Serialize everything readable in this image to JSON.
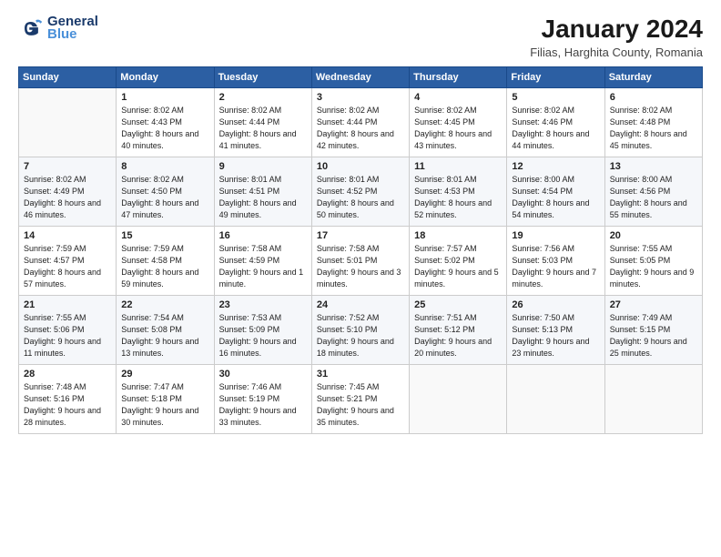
{
  "header": {
    "logo_line1": "General",
    "logo_line2": "Blue",
    "month_title": "January 2024",
    "location": "Filias, Harghita County, Romania"
  },
  "days_of_week": [
    "Sunday",
    "Monday",
    "Tuesday",
    "Wednesday",
    "Thursday",
    "Friday",
    "Saturday"
  ],
  "weeks": [
    [
      {
        "day": null,
        "sunrise": null,
        "sunset": null,
        "daylight": null
      },
      {
        "day": "1",
        "sunrise": "8:02 AM",
        "sunset": "4:43 PM",
        "daylight": "8 hours and 40 minutes."
      },
      {
        "day": "2",
        "sunrise": "8:02 AM",
        "sunset": "4:44 PM",
        "daylight": "8 hours and 41 minutes."
      },
      {
        "day": "3",
        "sunrise": "8:02 AM",
        "sunset": "4:44 PM",
        "daylight": "8 hours and 42 minutes."
      },
      {
        "day": "4",
        "sunrise": "8:02 AM",
        "sunset": "4:45 PM",
        "daylight": "8 hours and 43 minutes."
      },
      {
        "day": "5",
        "sunrise": "8:02 AM",
        "sunset": "4:46 PM",
        "daylight": "8 hours and 44 minutes."
      },
      {
        "day": "6",
        "sunrise": "8:02 AM",
        "sunset": "4:48 PM",
        "daylight": "8 hours and 45 minutes."
      }
    ],
    [
      {
        "day": "7",
        "sunrise": "8:02 AM",
        "sunset": "4:49 PM",
        "daylight": "8 hours and 46 minutes."
      },
      {
        "day": "8",
        "sunrise": "8:02 AM",
        "sunset": "4:50 PM",
        "daylight": "8 hours and 47 minutes."
      },
      {
        "day": "9",
        "sunrise": "8:01 AM",
        "sunset": "4:51 PM",
        "daylight": "8 hours and 49 minutes."
      },
      {
        "day": "10",
        "sunrise": "8:01 AM",
        "sunset": "4:52 PM",
        "daylight": "8 hours and 50 minutes."
      },
      {
        "day": "11",
        "sunrise": "8:01 AM",
        "sunset": "4:53 PM",
        "daylight": "8 hours and 52 minutes."
      },
      {
        "day": "12",
        "sunrise": "8:00 AM",
        "sunset": "4:54 PM",
        "daylight": "8 hours and 54 minutes."
      },
      {
        "day": "13",
        "sunrise": "8:00 AM",
        "sunset": "4:56 PM",
        "daylight": "8 hours and 55 minutes."
      }
    ],
    [
      {
        "day": "14",
        "sunrise": "7:59 AM",
        "sunset": "4:57 PM",
        "daylight": "8 hours and 57 minutes."
      },
      {
        "day": "15",
        "sunrise": "7:59 AM",
        "sunset": "4:58 PM",
        "daylight": "8 hours and 59 minutes."
      },
      {
        "day": "16",
        "sunrise": "7:58 AM",
        "sunset": "4:59 PM",
        "daylight": "9 hours and 1 minute."
      },
      {
        "day": "17",
        "sunrise": "7:58 AM",
        "sunset": "5:01 PM",
        "daylight": "9 hours and 3 minutes."
      },
      {
        "day": "18",
        "sunrise": "7:57 AM",
        "sunset": "5:02 PM",
        "daylight": "9 hours and 5 minutes."
      },
      {
        "day": "19",
        "sunrise": "7:56 AM",
        "sunset": "5:03 PM",
        "daylight": "9 hours and 7 minutes."
      },
      {
        "day": "20",
        "sunrise": "7:55 AM",
        "sunset": "5:05 PM",
        "daylight": "9 hours and 9 minutes."
      }
    ],
    [
      {
        "day": "21",
        "sunrise": "7:55 AM",
        "sunset": "5:06 PM",
        "daylight": "9 hours and 11 minutes."
      },
      {
        "day": "22",
        "sunrise": "7:54 AM",
        "sunset": "5:08 PM",
        "daylight": "9 hours and 13 minutes."
      },
      {
        "day": "23",
        "sunrise": "7:53 AM",
        "sunset": "5:09 PM",
        "daylight": "9 hours and 16 minutes."
      },
      {
        "day": "24",
        "sunrise": "7:52 AM",
        "sunset": "5:10 PM",
        "daylight": "9 hours and 18 minutes."
      },
      {
        "day": "25",
        "sunrise": "7:51 AM",
        "sunset": "5:12 PM",
        "daylight": "9 hours and 20 minutes."
      },
      {
        "day": "26",
        "sunrise": "7:50 AM",
        "sunset": "5:13 PM",
        "daylight": "9 hours and 23 minutes."
      },
      {
        "day": "27",
        "sunrise": "7:49 AM",
        "sunset": "5:15 PM",
        "daylight": "9 hours and 25 minutes."
      }
    ],
    [
      {
        "day": "28",
        "sunrise": "7:48 AM",
        "sunset": "5:16 PM",
        "daylight": "9 hours and 28 minutes."
      },
      {
        "day": "29",
        "sunrise": "7:47 AM",
        "sunset": "5:18 PM",
        "daylight": "9 hours and 30 minutes."
      },
      {
        "day": "30",
        "sunrise": "7:46 AM",
        "sunset": "5:19 PM",
        "daylight": "9 hours and 33 minutes."
      },
      {
        "day": "31",
        "sunrise": "7:45 AM",
        "sunset": "5:21 PM",
        "daylight": "9 hours and 35 minutes."
      },
      {
        "day": null,
        "sunrise": null,
        "sunset": null,
        "daylight": null
      },
      {
        "day": null,
        "sunrise": null,
        "sunset": null,
        "daylight": null
      },
      {
        "day": null,
        "sunrise": null,
        "sunset": null,
        "daylight": null
      }
    ]
  ]
}
